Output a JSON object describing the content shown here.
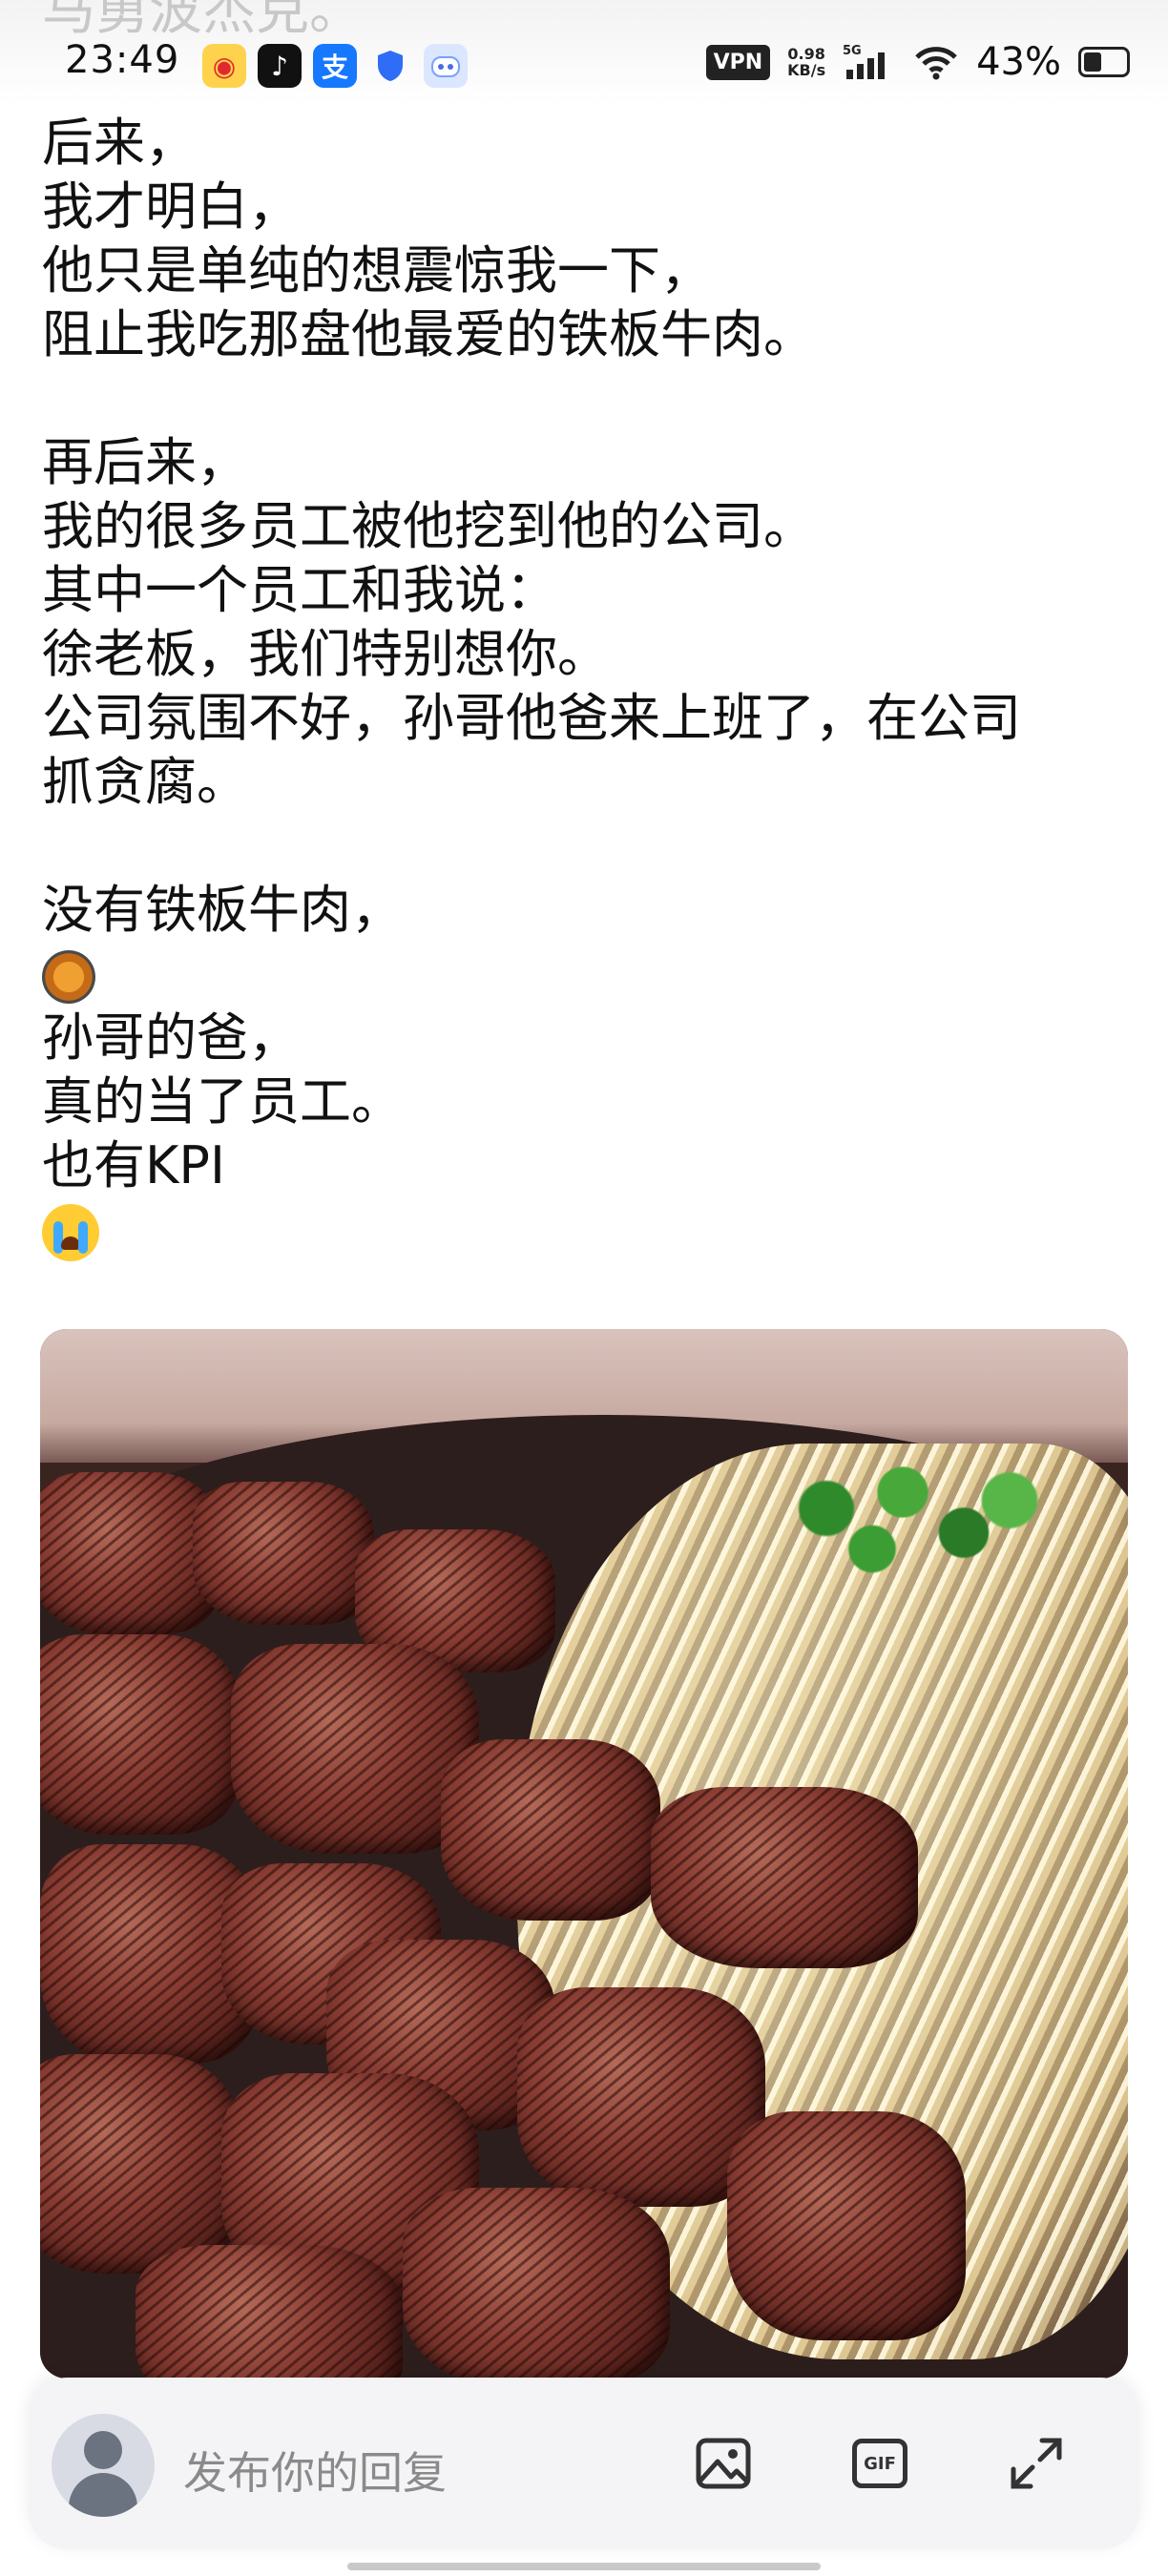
{
  "status_bar": {
    "scrolled_text": "马勇波杰克。",
    "time": "23:49",
    "app_icons": [
      "weibo-icon",
      "tiktok-icon",
      "alipay-icon",
      "shield-icon",
      "bot-icon"
    ],
    "vpn": "VPN",
    "net_speed_value": "0.98",
    "net_speed_unit": "KB/s",
    "network": "5G",
    "battery": "43%",
    "battery_level": 0.43
  },
  "post": {
    "lines": [
      "后来，",
      "我才明白，",
      "他只是单纯的想震惊我一下，",
      "阻止我吃那盘他最爱的铁板牛肉。",
      "",
      "再后来，",
      "我的很多员工被他挖到他的公司。",
      "其中一个员工和我说：",
      "徐老板，我们特别想你。",
      "公司氛围不好，孙哥他爸来上班了，在公司",
      "抓贪腐。",
      "",
      "没有铁板牛肉，",
      "[pan-emoji]",
      "孙哥的爸，",
      "真的当了员工。",
      "也有KPI",
      "[crying-emoji]"
    ],
    "image_subject": "sizzling-steak-photo"
  },
  "reply_bar": {
    "placeholder": "发布你的回复",
    "gif_label": "GIF"
  }
}
